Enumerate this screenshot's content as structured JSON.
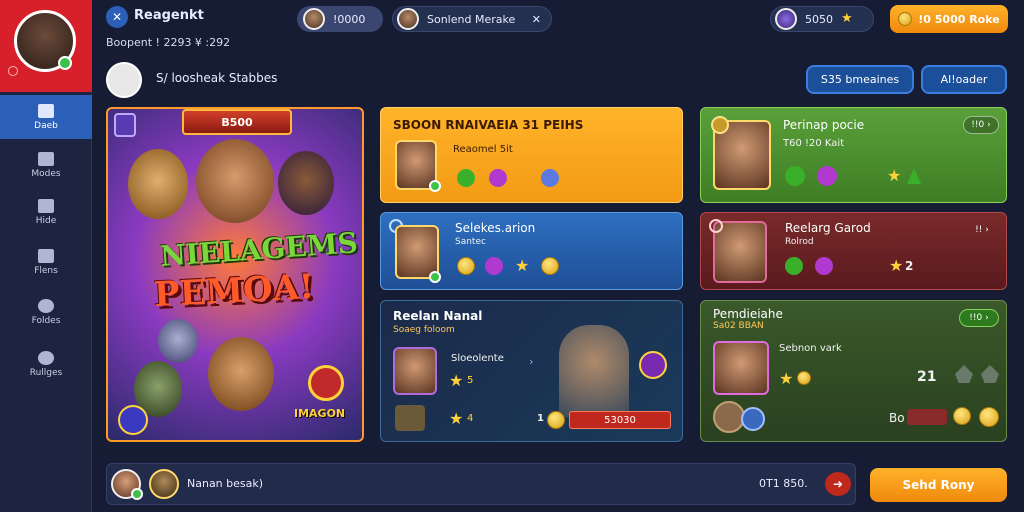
{
  "app": {
    "title": "Reagenkt",
    "stats": "Boopent ! 2293 ¥ :292"
  },
  "topbar": {
    "pill1": {
      "label": "!0000"
    },
    "pill2": {
      "label": "Sonlend Merake"
    },
    "currency": {
      "label": "5050"
    },
    "premium_button": {
      "label": "!0 5000 Roke"
    }
  },
  "subheader": {
    "label": "S/ loosheak Stabbes"
  },
  "header_buttons": {
    "btn1": "S35 bmeaines",
    "btn2": "Al!oader"
  },
  "sidebar": {
    "items": [
      {
        "label": "Daeb"
      },
      {
        "label": "Modes"
      },
      {
        "label": "Hide"
      },
      {
        "label": "Flens"
      },
      {
        "label": "Foldes"
      },
      {
        "label": "Rullges"
      }
    ]
  },
  "hero": {
    "badge": "B500",
    "title_line1": "NIELAGEMS",
    "title_line2": "PEMOA!",
    "corner_label": "IMAGON"
  },
  "cards": {
    "orange": {
      "title": "SBOON RNAIVAEIA 31 PEIHS",
      "subtitle": "Reaomel 5it"
    },
    "blue": {
      "title": "Selekes.arion",
      "subtitle": "Santec"
    },
    "dark": {
      "title": "Reelan Nanal",
      "subtitle": "Soaeg foloom",
      "name": "Sloeolente",
      "stars1": "5",
      "stars2": "4",
      "reward": "53030",
      "prefix": "1"
    },
    "green": {
      "title": "Perinap pocie",
      "subtitle": "T60 !20 Kait",
      "button": "!!0"
    },
    "red": {
      "title": "Reelarg Garod",
      "subtitle": "Rolrod",
      "button": "!!",
      "stars": "2"
    },
    "olive": {
      "title": "Pemdieiahe",
      "subtitle": "Sa02 BBAN",
      "button": "!!0",
      "name": "Sebnon vark",
      "value": "21",
      "count": "Bo"
    }
  },
  "bottom": {
    "player": "Nanan besak)",
    "score": "0T1 850.",
    "play_button": "Sehd Rony"
  },
  "colors": {
    "accent_orange": "#f5a623",
    "accent_blue": "#2b5fb8",
    "card_green": "#4a8a2a",
    "card_red": "#7a2a2a"
  }
}
